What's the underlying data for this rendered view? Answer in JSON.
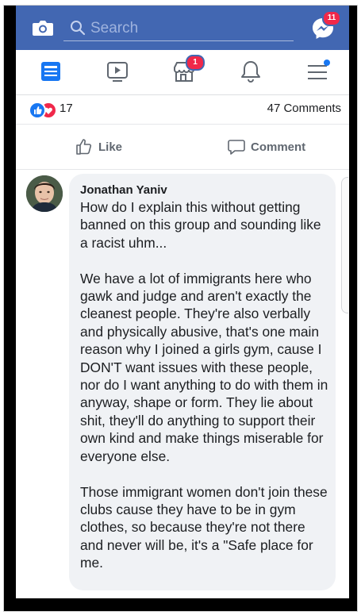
{
  "topbar": {
    "search_placeholder": "Search",
    "messenger_badge": "11",
    "brand_color": "#4267b2"
  },
  "nav": {
    "items": [
      {
        "name": "news-feed-icon",
        "active": true
      },
      {
        "name": "watch-icon"
      },
      {
        "name": "marketplace-icon",
        "badge": "1"
      },
      {
        "name": "notifications-icon"
      },
      {
        "name": "menu-icon",
        "dot": true
      }
    ]
  },
  "post": {
    "reaction_count": "17",
    "comments_count": "47 Comments",
    "like_label": "Like",
    "comment_label": "Comment"
  },
  "comment": {
    "author": "Jonathan Yaniv",
    "text": "How do I explain this without getting banned on this group and sounding like a racist uhm...\n\nWe have a lot of immigrants here who gawk and judge and aren't exactly the cleanest people. They're also verbally and physically abusive, that's one main reason why I joined a girls gym, cause I DON'T want issues with these people, nor do I want anything to do with them in anyway, shape or form. They lie about shit, they'll do anything to support their own kind and make things miserable for everyone else.\n\nThose immigrant women don't join these clubs cause they have to be in gym clothes, so because they're not there and never will be, it's a \"Safe place for me."
  }
}
